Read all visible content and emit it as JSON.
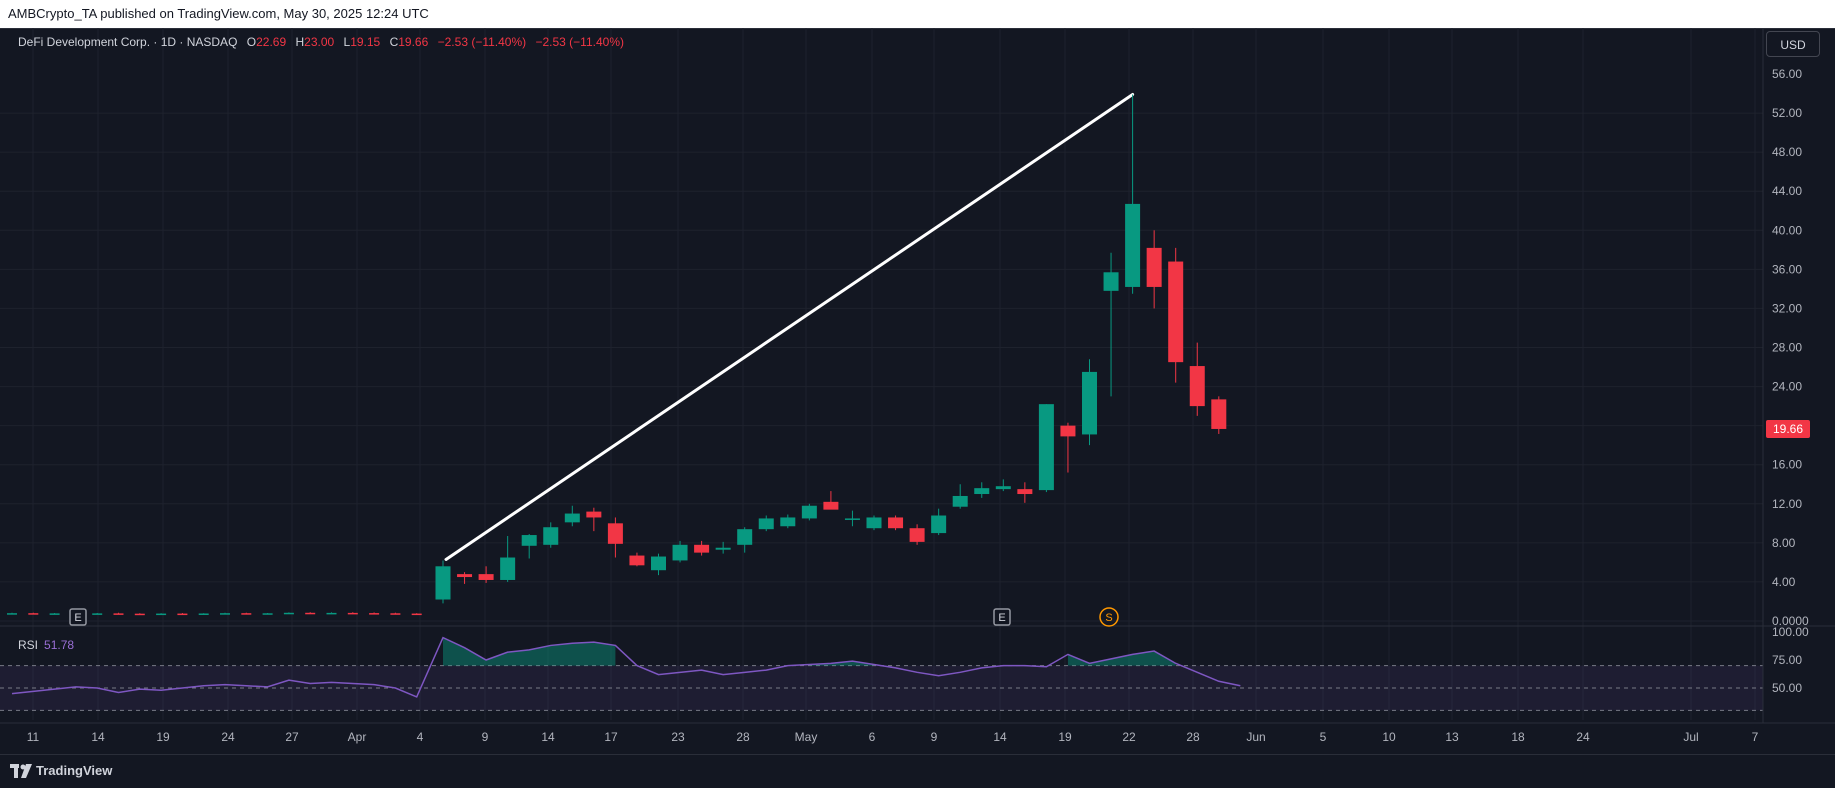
{
  "header": {
    "publish_line": "AMBCrypto_TA published on TradingView.com, May 30, 2025 12:24 UTC"
  },
  "legend": {
    "symbol": "DeFi Development Corp. · 1D · NASDAQ",
    "open_label": "O",
    "open": "22.69",
    "high_label": "H",
    "high": "23.00",
    "low_label": "L",
    "low": "19.15",
    "close_label": "C",
    "close": "19.66",
    "change": "−2.53 (−11.40%)",
    "change2": "−2.53 (−11.40%)"
  },
  "currency": "USD",
  "rsi": {
    "name": "RSI",
    "value": "51.78"
  },
  "footer": {
    "brand": "TradingView"
  },
  "colors": {
    "up": "#089981",
    "down": "#f23645",
    "background": "#131722",
    "grid": "#1e222d",
    "rsi_line": "#7e57c2",
    "trendline": "#ffffff"
  },
  "chart_data": {
    "type": "candlestick",
    "price_ticks": [
      "56.00",
      "52.00",
      "48.00",
      "44.00",
      "40.00",
      "36.00",
      "32.00",
      "28.00",
      "24.00",
      "20.00",
      "16.00",
      "12.00",
      "8.00",
      "4.00",
      "0.0000"
    ],
    "price_ylim": [
      0,
      56
    ],
    "rsi_ticks": [
      "100.00",
      "75.00",
      "50.00"
    ],
    "rsi_ylim": [
      25,
      100
    ],
    "x_ticks": [
      "11",
      "14",
      "19",
      "24",
      "27",
      "Apr",
      "4",
      "9",
      "14",
      "17",
      "23",
      "28",
      "May",
      "6",
      "9",
      "14",
      "19",
      "22",
      "28",
      "Jun",
      "5",
      "10",
      "13",
      "18",
      "24",
      "Jul",
      "7"
    ],
    "last_price_label": "19.66",
    "event_markers": [
      {
        "label": "E",
        "date": "Mar 14"
      },
      {
        "label": "E",
        "date": "May 13"
      },
      {
        "label": "S",
        "date": "May 19"
      }
    ],
    "trendline": {
      "from": {
        "date": "Apr 7",
        "price": 6.3
      },
      "to": {
        "date": "May 22",
        "price": 53.9
      }
    },
    "candles": [
      {
        "d": "Mar 10",
        "o": 0.75,
        "h": 0.85,
        "l": 0.7,
        "c": 0.8
      },
      {
        "d": "Mar 11",
        "o": 0.8,
        "h": 0.85,
        "l": 0.72,
        "c": 0.75
      },
      {
        "d": "Mar 12",
        "o": 0.75,
        "h": 0.82,
        "l": 0.7,
        "c": 0.78
      },
      {
        "d": "Mar 13",
        "o": 0.78,
        "h": 0.85,
        "l": 0.72,
        "c": 0.74
      },
      {
        "d": "Mar 14",
        "o": 0.74,
        "h": 0.82,
        "l": 0.7,
        "c": 0.78
      },
      {
        "d": "Mar 17",
        "o": 0.78,
        "h": 0.85,
        "l": 0.72,
        "c": 0.75
      },
      {
        "d": "Mar 18",
        "o": 0.75,
        "h": 0.8,
        "l": 0.68,
        "c": 0.72
      },
      {
        "d": "Mar 19",
        "o": 0.72,
        "h": 0.8,
        "l": 0.68,
        "c": 0.76
      },
      {
        "d": "Mar 20",
        "o": 0.76,
        "h": 0.82,
        "l": 0.7,
        "c": 0.73
      },
      {
        "d": "Mar 21",
        "o": 0.73,
        "h": 0.8,
        "l": 0.68,
        "c": 0.77
      },
      {
        "d": "Mar 24",
        "o": 0.77,
        "h": 0.85,
        "l": 0.72,
        "c": 0.8
      },
      {
        "d": "Mar 25",
        "o": 0.8,
        "h": 0.85,
        "l": 0.72,
        "c": 0.76
      },
      {
        "d": "Mar 26",
        "o": 0.76,
        "h": 0.82,
        "l": 0.7,
        "c": 0.79
      },
      {
        "d": "Mar 27",
        "o": 0.79,
        "h": 0.88,
        "l": 0.75,
        "c": 0.84
      },
      {
        "d": "Mar 28",
        "o": 0.84,
        "h": 0.9,
        "l": 0.78,
        "c": 0.8
      },
      {
        "d": "Mar 31",
        "o": 0.8,
        "h": 0.88,
        "l": 0.75,
        "c": 0.83
      },
      {
        "d": "Apr 1",
        "o": 0.83,
        "h": 0.9,
        "l": 0.78,
        "c": 0.81
      },
      {
        "d": "Apr 2",
        "o": 0.81,
        "h": 0.88,
        "l": 0.75,
        "c": 0.79
      },
      {
        "d": "Apr 3",
        "o": 0.79,
        "h": 0.85,
        "l": 0.72,
        "c": 0.76
      },
      {
        "d": "Apr 4",
        "o": 0.76,
        "h": 0.8,
        "l": 0.62,
        "c": 0.66
      },
      {
        "d": "Apr 7",
        "o": 2.2,
        "h": 6.2,
        "l": 1.8,
        "c": 5.6
      },
      {
        "d": "Apr 8",
        "o": 4.8,
        "h": 5.0,
        "l": 3.8,
        "c": 4.5
      },
      {
        "d": "Apr 9",
        "o": 4.8,
        "h": 5.6,
        "l": 3.9,
        "c": 4.2
      },
      {
        "d": "Apr 10",
        "o": 4.2,
        "h": 8.7,
        "l": 4.0,
        "c": 6.5
      },
      {
        "d": "Apr 11",
        "o": 7.7,
        "h": 8.9,
        "l": 6.4,
        "c": 8.8
      },
      {
        "d": "Apr 14",
        "o": 7.8,
        "h": 10.1,
        "l": 7.5,
        "c": 9.6
      },
      {
        "d": "Apr 15",
        "o": 10.1,
        "h": 11.8,
        "l": 9.7,
        "c": 11.0
      },
      {
        "d": "Apr 16",
        "o": 11.2,
        "h": 11.6,
        "l": 9.2,
        "c": 10.6
      },
      {
        "d": "Apr 17",
        "o": 10.0,
        "h": 10.6,
        "l": 6.5,
        "c": 7.9
      },
      {
        "d": "Apr 21",
        "o": 6.7,
        "h": 7.0,
        "l": 5.6,
        "c": 5.7
      },
      {
        "d": "Apr 22",
        "o": 5.2,
        "h": 6.9,
        "l": 4.7,
        "c": 6.6
      },
      {
        "d": "Apr 23",
        "o": 6.2,
        "h": 8.2,
        "l": 6.0,
        "c": 7.8
      },
      {
        "d": "Apr 24",
        "o": 7.8,
        "h": 8.2,
        "l": 6.7,
        "c": 7.0
      },
      {
        "d": "Apr 25",
        "o": 7.3,
        "h": 8.1,
        "l": 6.9,
        "c": 7.5
      },
      {
        "d": "Apr 28",
        "o": 7.8,
        "h": 9.6,
        "l": 7.0,
        "c": 9.4
      },
      {
        "d": "Apr 29",
        "o": 9.4,
        "h": 10.8,
        "l": 9.2,
        "c": 10.5
      },
      {
        "d": "Apr 30",
        "o": 9.7,
        "h": 10.9,
        "l": 9.5,
        "c": 10.6
      },
      {
        "d": "May 1",
        "o": 10.5,
        "h": 12.0,
        "l": 10.3,
        "c": 11.8
      },
      {
        "d": "May 2",
        "o": 12.2,
        "h": 13.3,
        "l": 11.5,
        "c": 11.4
      },
      {
        "d": "May 5",
        "o": 10.5,
        "h": 11.3,
        "l": 9.7,
        "c": 10.5
      },
      {
        "d": "May 6",
        "o": 9.5,
        "h": 10.8,
        "l": 9.3,
        "c": 10.6
      },
      {
        "d": "May 7",
        "o": 10.6,
        "h": 10.8,
        "l": 9.3,
        "c": 9.5
      },
      {
        "d": "May 8",
        "o": 9.5,
        "h": 9.9,
        "l": 7.8,
        "c": 8.1
      },
      {
        "d": "May 9",
        "o": 9.0,
        "h": 11.5,
        "l": 8.8,
        "c": 10.8
      },
      {
        "d": "May 12",
        "o": 11.7,
        "h": 14.0,
        "l": 11.5,
        "c": 12.8
      },
      {
        "d": "May 13",
        "o": 13.0,
        "h": 14.2,
        "l": 12.6,
        "c": 13.6
      },
      {
        "d": "May 14",
        "o": 13.5,
        "h": 14.5,
        "l": 13.3,
        "c": 13.8
      },
      {
        "d": "May 15",
        "o": 13.5,
        "h": 14.2,
        "l": 12.1,
        "c": 13.0
      },
      {
        "d": "May 16",
        "o": 13.4,
        "h": 22.2,
        "l": 13.2,
        "c": 22.2
      },
      {
        "d": "May 19",
        "o": 20.0,
        "h": 20.3,
        "l": 15.2,
        "c": 18.9
      },
      {
        "d": "May 20",
        "o": 19.1,
        "h": 26.8,
        "l": 18.0,
        "c": 25.5
      },
      {
        "d": "May 21",
        "o": 33.8,
        "h": 37.7,
        "l": 23.0,
        "c": 35.7
      },
      {
        "d": "May 22",
        "o": 34.2,
        "h": 53.9,
        "l": 33.5,
        "c": 42.7
      },
      {
        "d": "May 23",
        "o": 38.2,
        "h": 40.0,
        "l": 32.0,
        "c": 34.2
      },
      {
        "d": "May 27",
        "o": 36.8,
        "h": 38.2,
        "l": 24.4,
        "c": 26.5
      },
      {
        "d": "May 28",
        "o": 26.1,
        "h": 28.5,
        "l": 21.0,
        "c": 22.0
      },
      {
        "d": "May 29",
        "o": 22.69,
        "h": 23.0,
        "l": 19.15,
        "c": 19.66
      }
    ],
    "rsi_series": [
      45,
      47,
      49,
      51,
      50,
      46,
      49,
      48,
      50,
      52,
      53,
      52,
      51,
      57,
      54,
      55,
      54,
      53,
      50,
      42,
      95,
      86,
      75,
      82,
      84,
      88,
      90,
      91,
      88,
      70,
      62,
      64,
      66,
      62,
      64,
      66,
      70,
      71,
      72,
      74,
      71,
      68,
      64,
      61,
      64,
      68,
      70,
      70,
      69,
      80,
      72,
      76,
      80,
      83,
      72,
      64,
      56,
      52
    ]
  }
}
